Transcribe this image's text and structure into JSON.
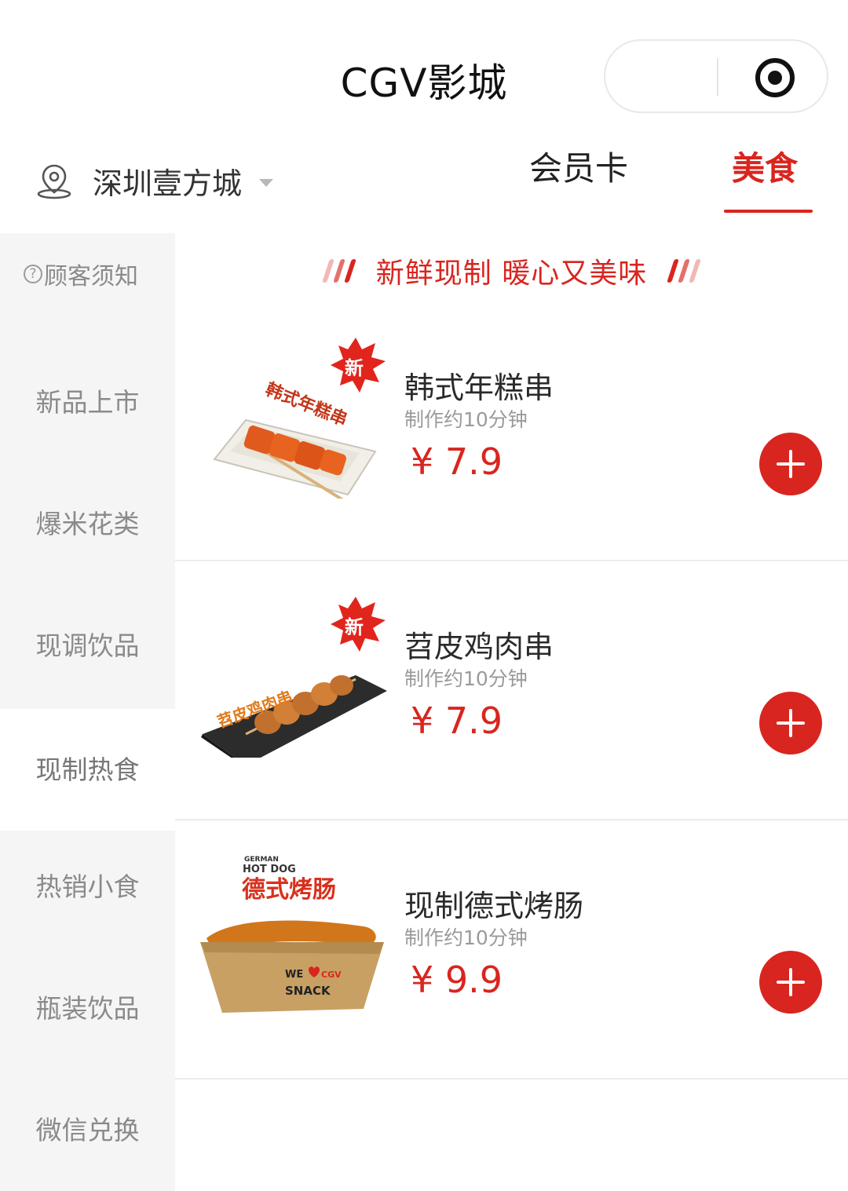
{
  "app": {
    "title": "CGV影城"
  },
  "location": {
    "name": "深圳壹方城"
  },
  "tabs": [
    {
      "label": "会员卡",
      "active": false
    },
    {
      "label": "美食",
      "active": true
    }
  ],
  "colors": {
    "accent": "#d9251f",
    "sidebar_bg": "#f5f5f5",
    "muted_text": "#8a8a8a"
  },
  "sidebar": {
    "notice": "顾客须知",
    "categories": [
      {
        "label": "新品上市"
      },
      {
        "label": "爆米花类"
      },
      {
        "label": "现调饮品"
      },
      {
        "label": "现制热食",
        "active": true
      },
      {
        "label": "热销小食"
      },
      {
        "label": "瓶装饮品"
      },
      {
        "label": "微信兑换"
      }
    ]
  },
  "banner": {
    "text": "新鲜现制 暖心又美味"
  },
  "products": [
    {
      "name": "韩式年糕串",
      "time": "制作约10分钟",
      "price": "¥ 7.9",
      "badge": "新",
      "image_caption": "韩式年糕串"
    },
    {
      "name": "苕皮鸡肉串",
      "time": "制作约10分钟",
      "price": "¥ 7.9",
      "badge": "新",
      "image_caption": "苕皮鸡肉串"
    },
    {
      "name": "现制德式烤肠",
      "time": "制作约10分钟",
      "price": "¥ 9.9",
      "image_caption": "德式烤肠",
      "image_sub1": "GERMAN",
      "image_sub2": "HOT DOG",
      "image_box_text1": "WE",
      "image_box_text2": "CGV",
      "image_box_text3": "SNACK"
    }
  ]
}
